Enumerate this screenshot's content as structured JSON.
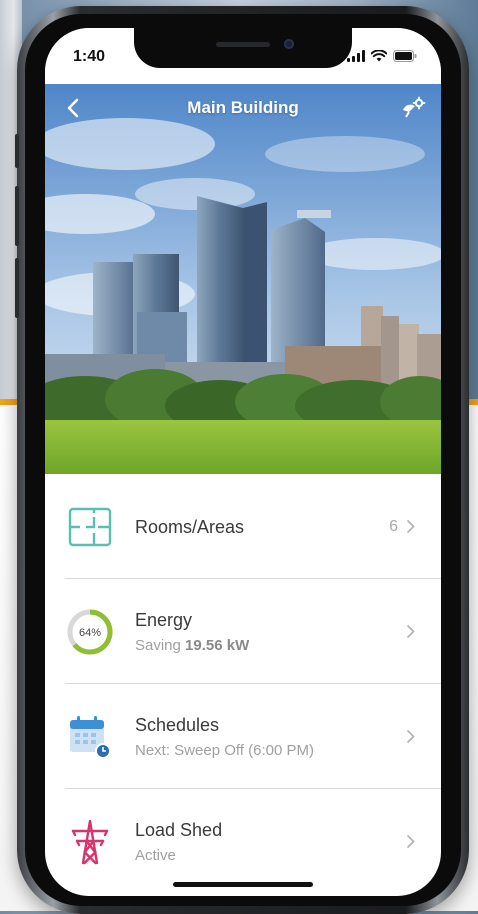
{
  "status_bar": {
    "time": "1:40"
  },
  "header": {
    "title": "Main Building",
    "back_icon": "chevron-left-icon",
    "settings_icon": "satellite-gear-icon"
  },
  "menu": {
    "items": [
      {
        "key": "rooms",
        "title": "Rooms/Areas",
        "count": "6",
        "icon": "floorplan-icon"
      },
      {
        "key": "energy",
        "title": "Energy",
        "sub_prefix": "Saving ",
        "sub_value": "19.56 kW",
        "gauge_text": "64%",
        "gauge_value": 0.64,
        "icon": "energy-gauge-icon"
      },
      {
        "key": "schedules",
        "title": "Schedules",
        "subtitle": "Next: Sweep Off (6:00 PM)",
        "icon": "calendar-clock-icon"
      },
      {
        "key": "loadshed",
        "title": "Load Shed",
        "subtitle": "Active",
        "icon": "transmission-tower-icon"
      }
    ]
  },
  "colors": {
    "teal": "#5bbfae",
    "green": "#8fbf32",
    "blue": "#3d8fd6",
    "pink": "#d9336e",
    "chevron": "#b5b5b5"
  }
}
